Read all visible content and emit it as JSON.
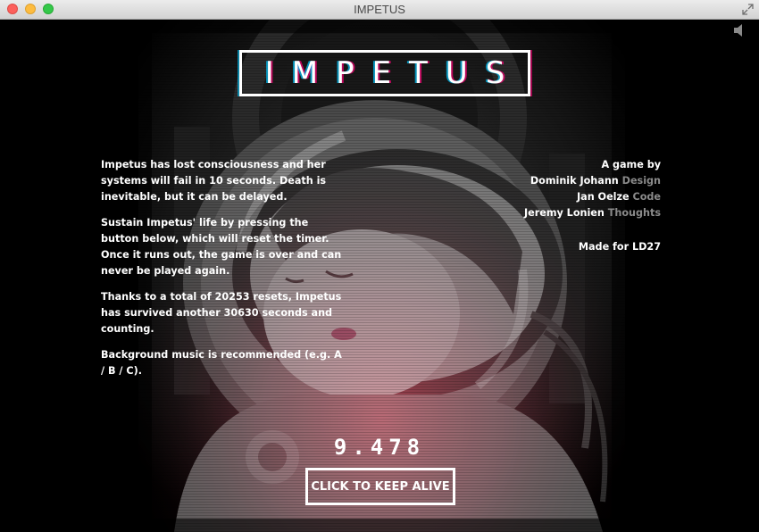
{
  "window": {
    "title": "IMPETUS"
  },
  "game": {
    "logo": "IMPETUS",
    "intro": [
      "Impetus has lost consciousness and her systems will fail in 10 seconds. Death is inevitable, but it can be delayed.",
      "Sustain Impetus' life by pressing the button below, which will reset the timer. Once it runs out, the game is over and can never be played again.",
      "Thanks to a total of 20253 resets, Impetus has survived another 30630 seconds and counting.",
      "Background music is recommended (e.g. A / B / C)."
    ],
    "credits": {
      "heading": "A game by",
      "people": [
        {
          "name": "Dominik Johann",
          "role": "Design"
        },
        {
          "name": "Jan Oelze",
          "role": "Code"
        },
        {
          "name": "Jeremy Lonien",
          "role": "Thoughts"
        }
      ],
      "made_for": "Made for LD27"
    },
    "timer": "9.478",
    "button_label": "CLICK TO KEEP ALIVE"
  },
  "colors": {
    "background": "#000000",
    "text": "#ffffff",
    "role_text": "#8a8a8a",
    "glow_red": "#8b1a2a"
  },
  "icons": {
    "window_controls": [
      "close-icon",
      "minimize-icon",
      "maximize-icon"
    ],
    "fullscreen": "fullscreen-icon",
    "sound": "speaker-icon"
  }
}
